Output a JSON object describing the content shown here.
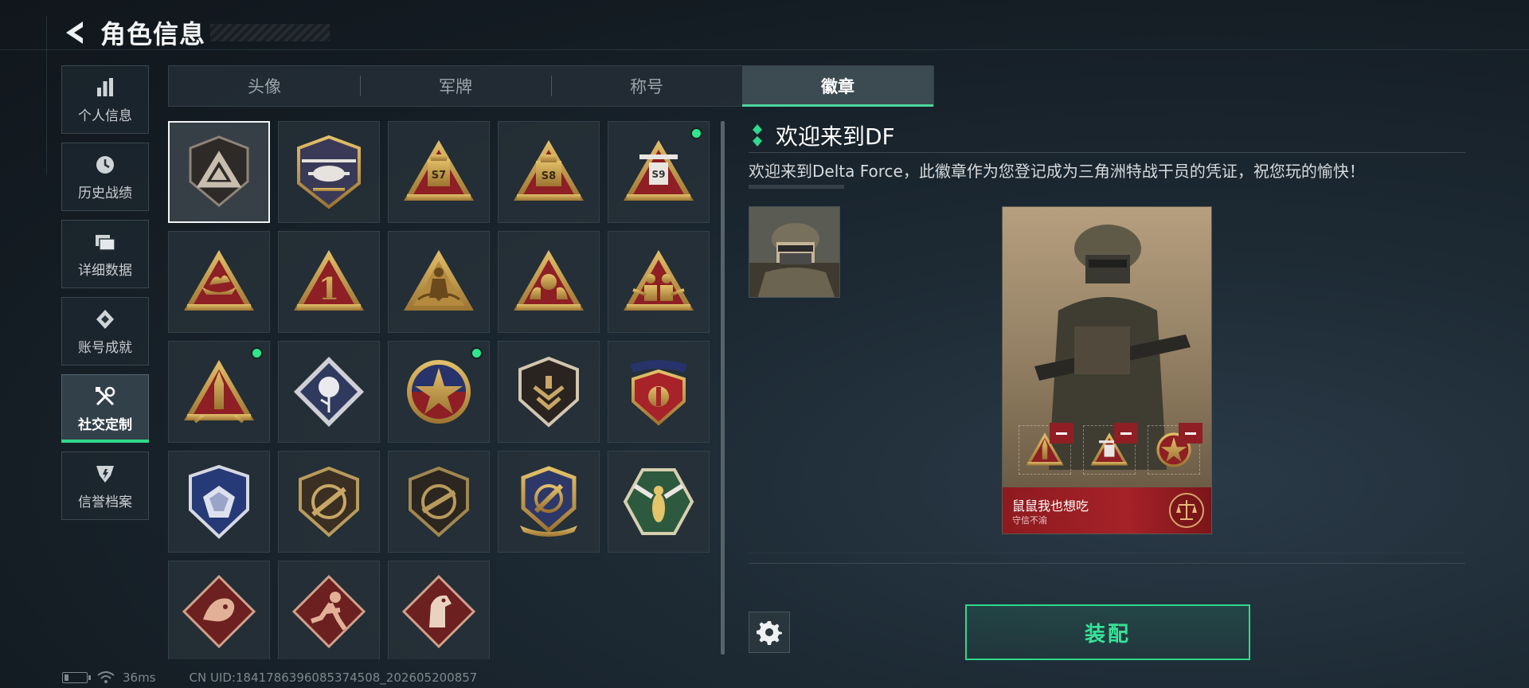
{
  "header": {
    "title": "角色信息"
  },
  "sidenav": {
    "items": [
      {
        "label": "个人信息",
        "icon": "bar-chart-icon"
      },
      {
        "label": "历史战绩",
        "icon": "clock-icon"
      },
      {
        "label": "详细数据",
        "icon": "folder-icon"
      },
      {
        "label": "账号成就",
        "icon": "achievement-icon"
      },
      {
        "label": "社交定制",
        "icon": "tools-icon",
        "active": true
      },
      {
        "label": "信誉档案",
        "icon": "shield-star-icon"
      }
    ]
  },
  "tabs": [
    {
      "label": "头像"
    },
    {
      "label": "军牌"
    },
    {
      "label": "称号"
    },
    {
      "label": "徽章",
      "active": true
    }
  ],
  "badges": [
    {
      "icon": "delta-shield-badge-icon",
      "selected": true,
      "new": false
    },
    {
      "icon": "helicopter-badge-icon",
      "new": false
    },
    {
      "icon": "s7-badge-icon",
      "label": "S7",
      "new": false
    },
    {
      "icon": "s8-badge-icon",
      "label": "S8",
      "new": false
    },
    {
      "icon": "s9-badge-icon",
      "label": "S9",
      "new": true
    },
    {
      "icon": "boat-triangle-badge-icon",
      "new": false
    },
    {
      "icon": "number-one-badge-icon",
      "label": "1",
      "new": false
    },
    {
      "icon": "dancer-triangle-badge-icon",
      "new": false
    },
    {
      "icon": "hands-triangle-badge-icon",
      "new": false
    },
    {
      "icon": "soldiers-triangle-badge-icon",
      "new": false
    },
    {
      "icon": "rocket-triangle-badge-icon",
      "new": true
    },
    {
      "icon": "rose-badge-icon",
      "new": false
    },
    {
      "icon": "star-round-badge-icon",
      "new": true
    },
    {
      "icon": "chevron-shield-badge-icon",
      "new": false
    },
    {
      "icon": "red-crest-badge-icon",
      "new": false
    },
    {
      "icon": "diamond-crest-badge-icon",
      "new": false
    },
    {
      "icon": "rifle-shield-badge-icon",
      "new": false
    },
    {
      "icon": "rifle-shield-dark-badge-icon",
      "new": false
    },
    {
      "icon": "crosshair-crest-badge-icon",
      "new": false
    },
    {
      "icon": "hornet-badge-icon",
      "new": false
    },
    {
      "icon": "dragon-badge-icon",
      "new": false
    },
    {
      "icon": "runner-badge-icon",
      "new": false
    },
    {
      "icon": "horse-badge-icon",
      "new": false
    }
  ],
  "detail": {
    "name": "欢迎来到DF",
    "description": "欢迎来到Delta Force，此徽章作为您登记成为三角洲特战干员的凭证，祝您玩的愉快！",
    "card": {
      "player_name": "鼠鼠我也想吃",
      "player_subtitle": "守信不渝",
      "equipped_badges": [
        "rocket-triangle-badge-icon",
        "s9-badge-icon",
        "star-round-badge-icon"
      ]
    },
    "equip_label": "装配"
  },
  "status": {
    "ping": "36ms",
    "uid": "CN UID:18417863960853​74508_202605200857"
  },
  "colors": {
    "accent_green": "#2fd98b",
    "gold": "#c9a24a",
    "badge_red": "#8e1f24",
    "card_footer_red": "#a52228"
  }
}
